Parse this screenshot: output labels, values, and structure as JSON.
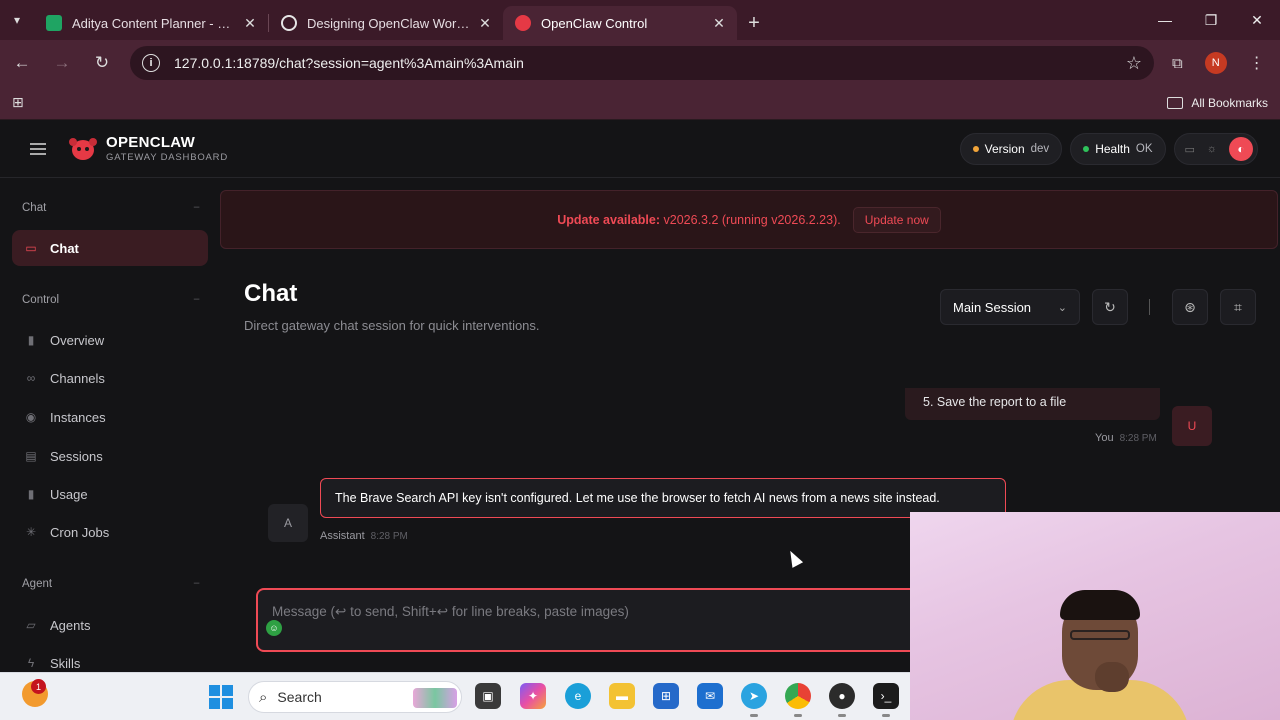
{
  "browser": {
    "tabs": [
      {
        "title": "Aditya Content Planner - Google",
        "favicon_color": "#1fa463"
      },
      {
        "title": "Designing OpenClaw Workflow",
        "favicon_color": "#e6e6e6"
      },
      {
        "title": "OpenClaw Control",
        "favicon_color": "#e53945"
      }
    ],
    "url": "127.0.0.1:18789/chat?session=agent%3Amain%3Amain",
    "profile_initial": "N",
    "all_bookmarks_label": "All Bookmarks"
  },
  "app": {
    "brand_name": "OPENCLAW",
    "brand_sub": "GATEWAY DASHBOARD",
    "version_label": "Version",
    "version_value": "dev",
    "health_label": "Health",
    "health_value": "OK",
    "accent": "#ef4a55"
  },
  "sidebar": {
    "sections": [
      {
        "label": "Chat",
        "collapse": "−"
      },
      {
        "label": "Control",
        "collapse": "−"
      },
      {
        "label": "Agent",
        "collapse": "−"
      }
    ],
    "items": [
      {
        "label": "Chat",
        "icon": "chat-bubble-icon"
      },
      {
        "label": "Overview",
        "icon": "bar-chart-icon"
      },
      {
        "label": "Channels",
        "icon": "link-icon"
      },
      {
        "label": "Instances",
        "icon": "radio-icon"
      },
      {
        "label": "Sessions",
        "icon": "document-icon"
      },
      {
        "label": "Usage",
        "icon": "bar-chart-icon"
      },
      {
        "label": "Cron Jobs",
        "icon": "loader-icon"
      },
      {
        "label": "Agents",
        "icon": "folder-icon"
      },
      {
        "label": "Skills",
        "icon": "bolt-icon"
      }
    ]
  },
  "banner": {
    "title": "Update available:",
    "detail": "v2026.3.2 (running v2026.2.23).",
    "button": "Update now"
  },
  "chat": {
    "title": "Chat",
    "subtitle": "Direct gateway chat session for quick interventions.",
    "session_select": "Main Session",
    "messages": [
      {
        "role": "You",
        "avatar": "U",
        "text": "5. Save the report to a file",
        "time": "8:28 PM"
      },
      {
        "role": "Assistant",
        "avatar": "A",
        "text": "The Brave Search API key isn't configured. Let me use the browser to fetch AI news from a news site instead.",
        "time": "8:28 PM"
      }
    ],
    "composer_placeholder": "Message (↩ to send, Shift+↩ for line breaks, paste images)"
  },
  "taskbar": {
    "search_label": "Search",
    "notification_count": "1"
  }
}
